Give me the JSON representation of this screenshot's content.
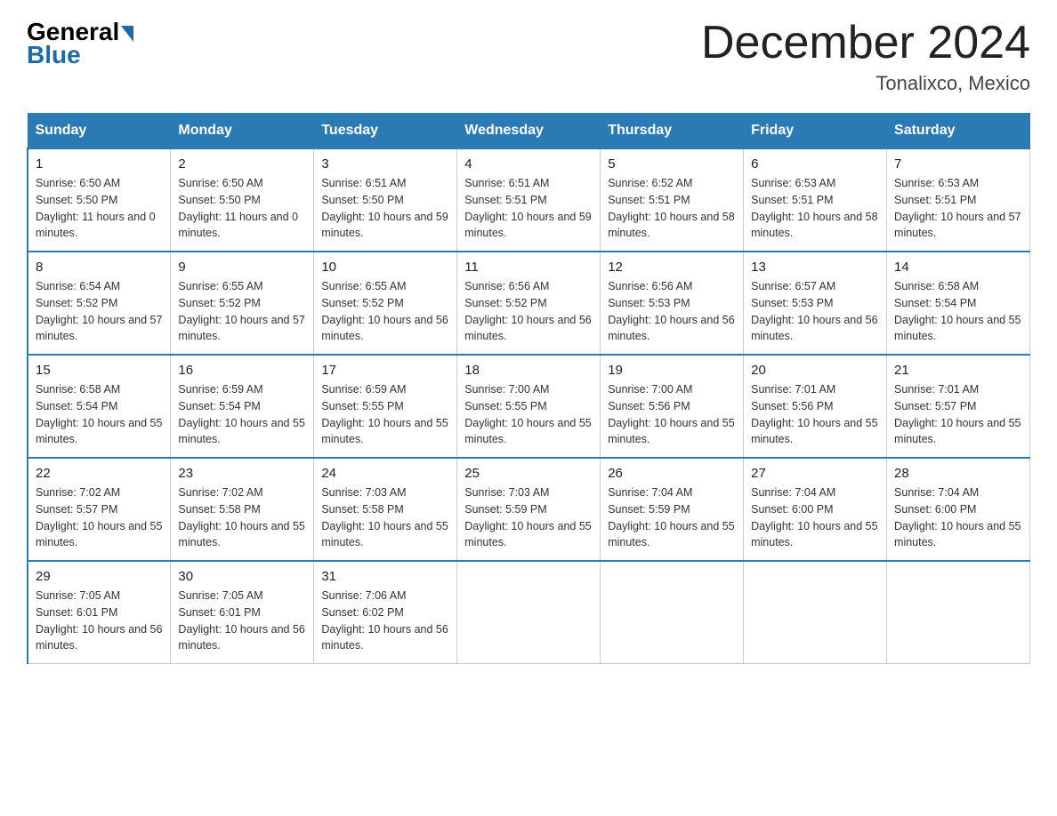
{
  "header": {
    "logo_general": "General",
    "logo_blue": "Blue",
    "month_title": "December 2024",
    "location": "Tonalixco, Mexico"
  },
  "days_of_week": [
    "Sunday",
    "Monday",
    "Tuesday",
    "Wednesday",
    "Thursday",
    "Friday",
    "Saturday"
  ],
  "weeks": [
    [
      {
        "day": "1",
        "sunrise": "6:50 AM",
        "sunset": "5:50 PM",
        "daylight": "11 hours and 0 minutes."
      },
      {
        "day": "2",
        "sunrise": "6:50 AM",
        "sunset": "5:50 PM",
        "daylight": "11 hours and 0 minutes."
      },
      {
        "day": "3",
        "sunrise": "6:51 AM",
        "sunset": "5:50 PM",
        "daylight": "10 hours and 59 minutes."
      },
      {
        "day": "4",
        "sunrise": "6:51 AM",
        "sunset": "5:51 PM",
        "daylight": "10 hours and 59 minutes."
      },
      {
        "day": "5",
        "sunrise": "6:52 AM",
        "sunset": "5:51 PM",
        "daylight": "10 hours and 58 minutes."
      },
      {
        "day": "6",
        "sunrise": "6:53 AM",
        "sunset": "5:51 PM",
        "daylight": "10 hours and 58 minutes."
      },
      {
        "day": "7",
        "sunrise": "6:53 AM",
        "sunset": "5:51 PM",
        "daylight": "10 hours and 57 minutes."
      }
    ],
    [
      {
        "day": "8",
        "sunrise": "6:54 AM",
        "sunset": "5:52 PM",
        "daylight": "10 hours and 57 minutes."
      },
      {
        "day": "9",
        "sunrise": "6:55 AM",
        "sunset": "5:52 PM",
        "daylight": "10 hours and 57 minutes."
      },
      {
        "day": "10",
        "sunrise": "6:55 AM",
        "sunset": "5:52 PM",
        "daylight": "10 hours and 56 minutes."
      },
      {
        "day": "11",
        "sunrise": "6:56 AM",
        "sunset": "5:52 PM",
        "daylight": "10 hours and 56 minutes."
      },
      {
        "day": "12",
        "sunrise": "6:56 AM",
        "sunset": "5:53 PM",
        "daylight": "10 hours and 56 minutes."
      },
      {
        "day": "13",
        "sunrise": "6:57 AM",
        "sunset": "5:53 PM",
        "daylight": "10 hours and 56 minutes."
      },
      {
        "day": "14",
        "sunrise": "6:58 AM",
        "sunset": "5:54 PM",
        "daylight": "10 hours and 55 minutes."
      }
    ],
    [
      {
        "day": "15",
        "sunrise": "6:58 AM",
        "sunset": "5:54 PM",
        "daylight": "10 hours and 55 minutes."
      },
      {
        "day": "16",
        "sunrise": "6:59 AM",
        "sunset": "5:54 PM",
        "daylight": "10 hours and 55 minutes."
      },
      {
        "day": "17",
        "sunrise": "6:59 AM",
        "sunset": "5:55 PM",
        "daylight": "10 hours and 55 minutes."
      },
      {
        "day": "18",
        "sunrise": "7:00 AM",
        "sunset": "5:55 PM",
        "daylight": "10 hours and 55 minutes."
      },
      {
        "day": "19",
        "sunrise": "7:00 AM",
        "sunset": "5:56 PM",
        "daylight": "10 hours and 55 minutes."
      },
      {
        "day": "20",
        "sunrise": "7:01 AM",
        "sunset": "5:56 PM",
        "daylight": "10 hours and 55 minutes."
      },
      {
        "day": "21",
        "sunrise": "7:01 AM",
        "sunset": "5:57 PM",
        "daylight": "10 hours and 55 minutes."
      }
    ],
    [
      {
        "day": "22",
        "sunrise": "7:02 AM",
        "sunset": "5:57 PM",
        "daylight": "10 hours and 55 minutes."
      },
      {
        "day": "23",
        "sunrise": "7:02 AM",
        "sunset": "5:58 PM",
        "daylight": "10 hours and 55 minutes."
      },
      {
        "day": "24",
        "sunrise": "7:03 AM",
        "sunset": "5:58 PM",
        "daylight": "10 hours and 55 minutes."
      },
      {
        "day": "25",
        "sunrise": "7:03 AM",
        "sunset": "5:59 PM",
        "daylight": "10 hours and 55 minutes."
      },
      {
        "day": "26",
        "sunrise": "7:04 AM",
        "sunset": "5:59 PM",
        "daylight": "10 hours and 55 minutes."
      },
      {
        "day": "27",
        "sunrise": "7:04 AM",
        "sunset": "6:00 PM",
        "daylight": "10 hours and 55 minutes."
      },
      {
        "day": "28",
        "sunrise": "7:04 AM",
        "sunset": "6:00 PM",
        "daylight": "10 hours and 55 minutes."
      }
    ],
    [
      {
        "day": "29",
        "sunrise": "7:05 AM",
        "sunset": "6:01 PM",
        "daylight": "10 hours and 56 minutes."
      },
      {
        "day": "30",
        "sunrise": "7:05 AM",
        "sunset": "6:01 PM",
        "daylight": "10 hours and 56 minutes."
      },
      {
        "day": "31",
        "sunrise": "7:06 AM",
        "sunset": "6:02 PM",
        "daylight": "10 hours and 56 minutes."
      },
      null,
      null,
      null,
      null
    ]
  ],
  "labels": {
    "sunrise": "Sunrise:",
    "sunset": "Sunset:",
    "daylight": "Daylight:"
  }
}
